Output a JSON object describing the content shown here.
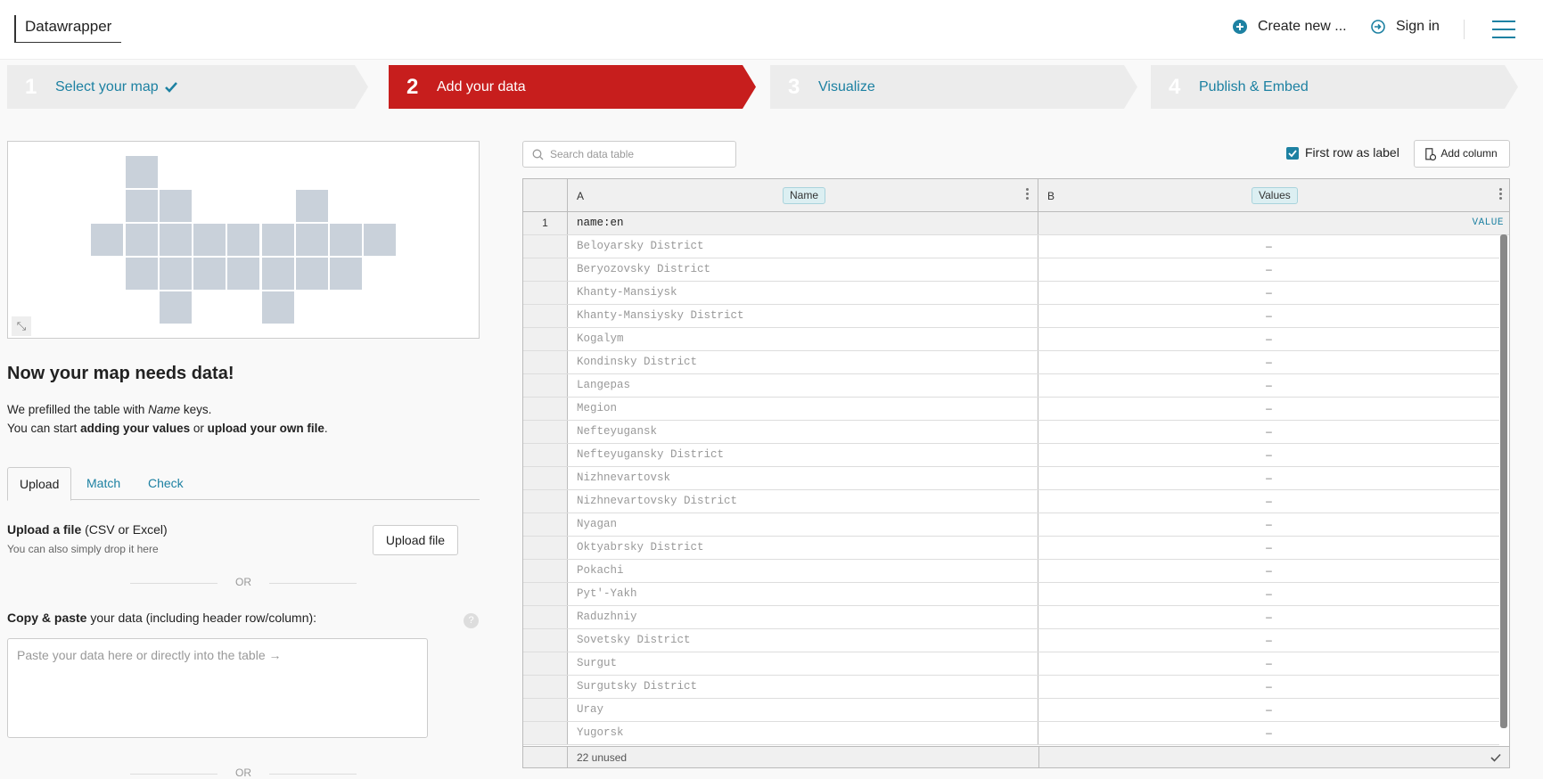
{
  "app": {
    "title": "Datawrapper"
  },
  "topnav": {
    "create_label": "Create new ...",
    "signin_label": "Sign in"
  },
  "steps": [
    {
      "num": "1",
      "label": "Select your map",
      "state": "done"
    },
    {
      "num": "2",
      "label": "Add your data",
      "state": "active"
    },
    {
      "num": "3",
      "label": "Visualize",
      "state": "todo"
    },
    {
      "num": "4",
      "label": "Publish & Embed",
      "state": "todo"
    }
  ],
  "colors": {
    "accent": "#1d81a2",
    "active_step": "#c71e1d",
    "inactive_step": "#ececec"
  },
  "intro": {
    "heading": "Now your map needs data!",
    "line1_pre": "We prefilled the table with ",
    "line1_em": "Name",
    "line1_post": " keys.",
    "line2_pre": "You can start ",
    "line2_b1": "adding your values",
    "line2_mid": " or ",
    "line2_b2": "upload your own file",
    "line2_post": "."
  },
  "tabs": [
    {
      "label": "Upload",
      "active": true
    },
    {
      "label": "Match",
      "active": false
    },
    {
      "label": "Check",
      "active": false
    }
  ],
  "upload": {
    "title_bold": "Upload a file",
    "title_rest": " (CSV or Excel)",
    "subtitle": "You can also simply drop it here",
    "button_label": "Upload file",
    "or_label": "OR"
  },
  "paste": {
    "title_bold": "Copy & paste",
    "title_rest": " your data (including header row/column):",
    "help": "?",
    "placeholder": "Paste your data here or directly into the table →"
  },
  "table_toolbar": {
    "search_placeholder": "Search data table",
    "first_row_label": "First row as label",
    "first_row_checked": true,
    "add_column_label": "Add column"
  },
  "table": {
    "columns": [
      {
        "letter": "A",
        "type": "Name"
      },
      {
        "letter": "B",
        "type": "Values"
      }
    ],
    "header_row": {
      "num": "1",
      "a": "name:en",
      "b": "VALUE"
    },
    "rows": [
      {
        "a": "Beloyarsky District",
        "b": "–"
      },
      {
        "a": "Beryozovsky District",
        "b": "–"
      },
      {
        "a": "Khanty-Mansiysk",
        "b": "–"
      },
      {
        "a": "Khanty-Mansiysky District",
        "b": "–"
      },
      {
        "a": "Kogalym",
        "b": "–"
      },
      {
        "a": "Kondinsky District",
        "b": "–"
      },
      {
        "a": "Langepas",
        "b": "–"
      },
      {
        "a": "Megion",
        "b": "–"
      },
      {
        "a": "Nefteyugansk",
        "b": "–"
      },
      {
        "a": "Nefteyugansky District",
        "b": "–"
      },
      {
        "a": "Nizhnevartovsk",
        "b": "–"
      },
      {
        "a": "Nizhnevartovsky District",
        "b": "–"
      },
      {
        "a": "Nyagan",
        "b": "–"
      },
      {
        "a": "Oktyabrsky District",
        "b": "–"
      },
      {
        "a": "Pokachi",
        "b": "–"
      },
      {
        "a": "Pyt'-Yakh",
        "b": "–"
      },
      {
        "a": "Raduzhniy",
        "b": "–"
      },
      {
        "a": "Sovetsky District",
        "b": "–"
      },
      {
        "a": "Surgut",
        "b": "–"
      },
      {
        "a": "Surgutsky District",
        "b": "–"
      },
      {
        "a": "Uray",
        "b": "–"
      },
      {
        "a": "Yugorsk",
        "b": "–"
      }
    ],
    "footer": {
      "a": "22 unused",
      "b_icon": "check-icon"
    }
  }
}
